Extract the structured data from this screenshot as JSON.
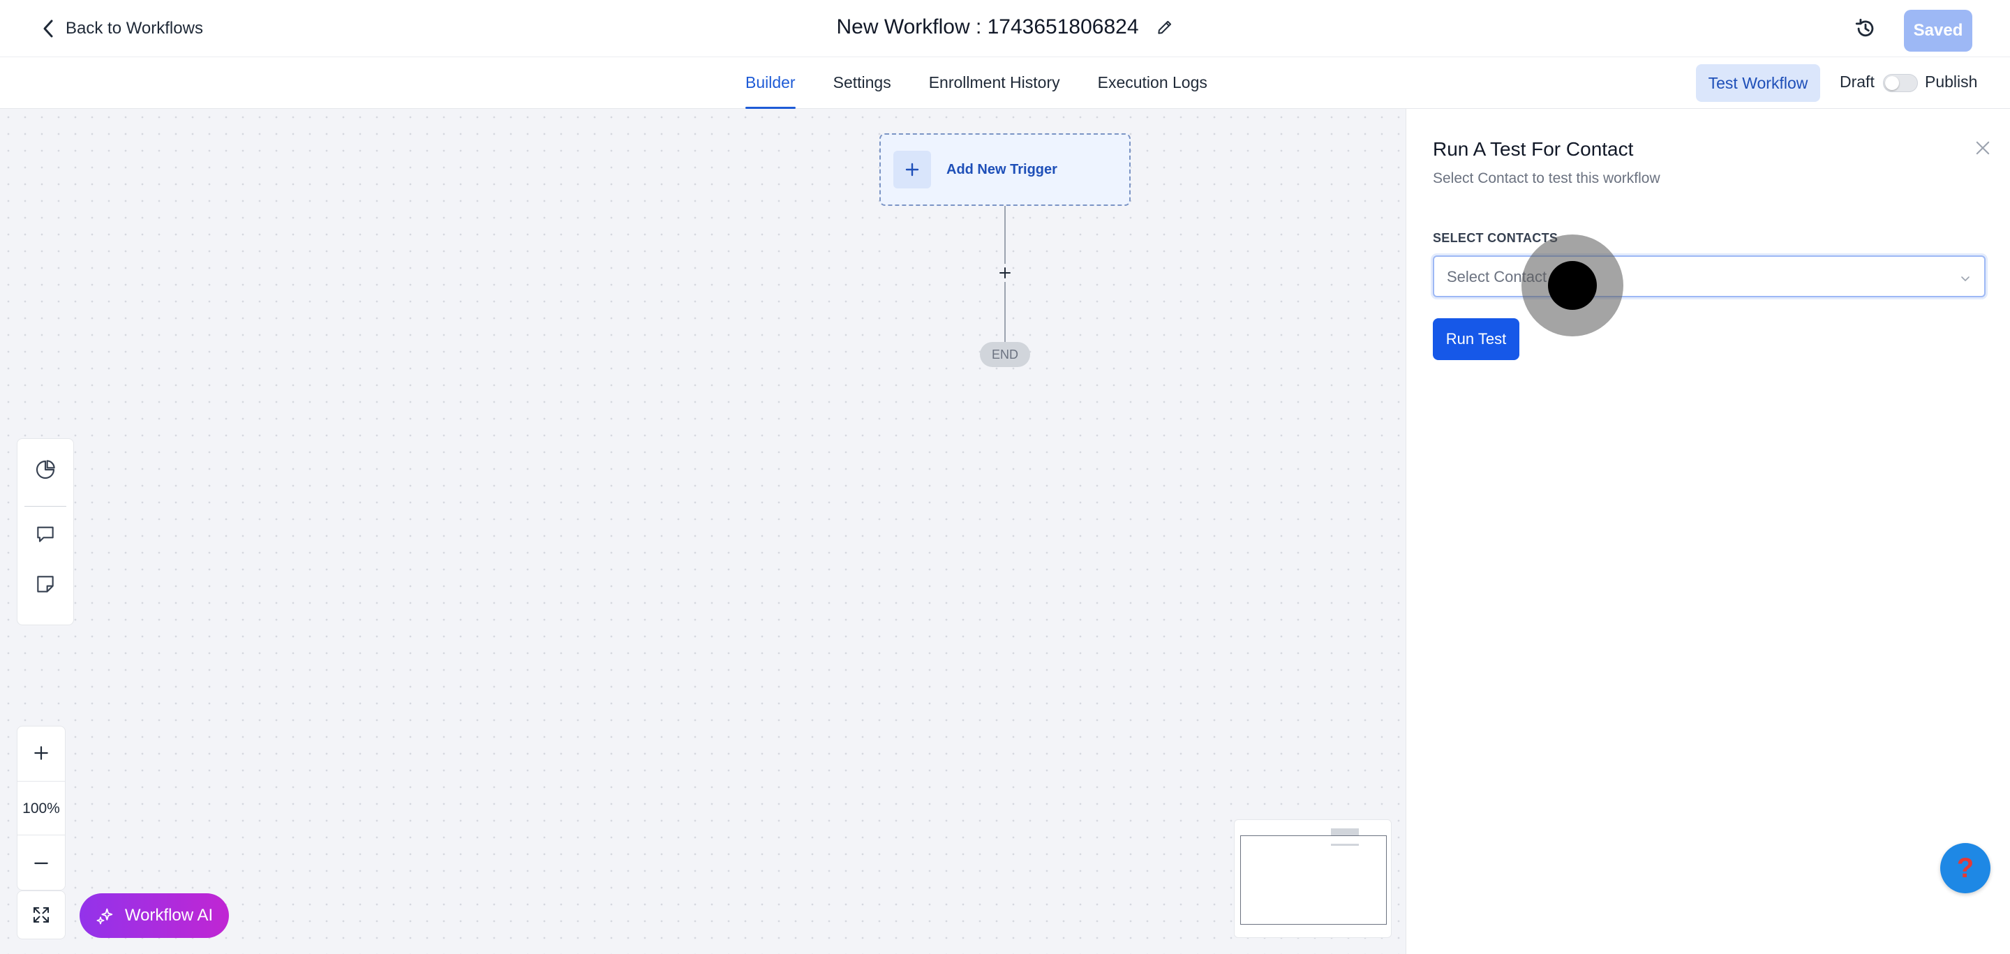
{
  "header": {
    "back_label": "Back to Workflows",
    "workflow_title": "New Workflow : 1743651806824",
    "saved_label": "Saved"
  },
  "tabs": [
    {
      "label": "Builder",
      "active": true
    },
    {
      "label": "Settings",
      "active": false
    },
    {
      "label": "Enrollment History",
      "active": false
    },
    {
      "label": "Execution Logs",
      "active": false
    }
  ],
  "actions": {
    "test_workflow_label": "Test Workflow",
    "draft_label": "Draft",
    "publish_label": "Publish",
    "publish_toggle_on": false
  },
  "canvas": {
    "trigger_label": "Add New Trigger",
    "end_label": "END",
    "zoom": "100%",
    "workflow_ai_label": "Workflow AI"
  },
  "test_panel": {
    "title": "Run A Test For Contact",
    "subtitle": "Select Contact to test this workflow",
    "field_label": "SELECT CONTACTS",
    "select_placeholder": "Select Contact",
    "run_button": "Run Test"
  },
  "help": {
    "glyph": "?"
  },
  "icons": [
    "chevron-left-icon",
    "pencil-icon",
    "history-icon",
    "plus-icon",
    "pie-chart-icon",
    "comment-icon",
    "sticky-note-icon",
    "zoom-in-icon",
    "zoom-out-icon",
    "fit-screen-icon",
    "sparkle-icon",
    "close-icon",
    "chevron-down-icon",
    "help-icon"
  ],
  "colors": {
    "accent": "#1658e8",
    "tab_active": "#1e5bd6",
    "ai_gradient_start": "#9333ea",
    "ai_gradient_end": "#c026d3",
    "saved_disabled": "#9db8f5"
  }
}
